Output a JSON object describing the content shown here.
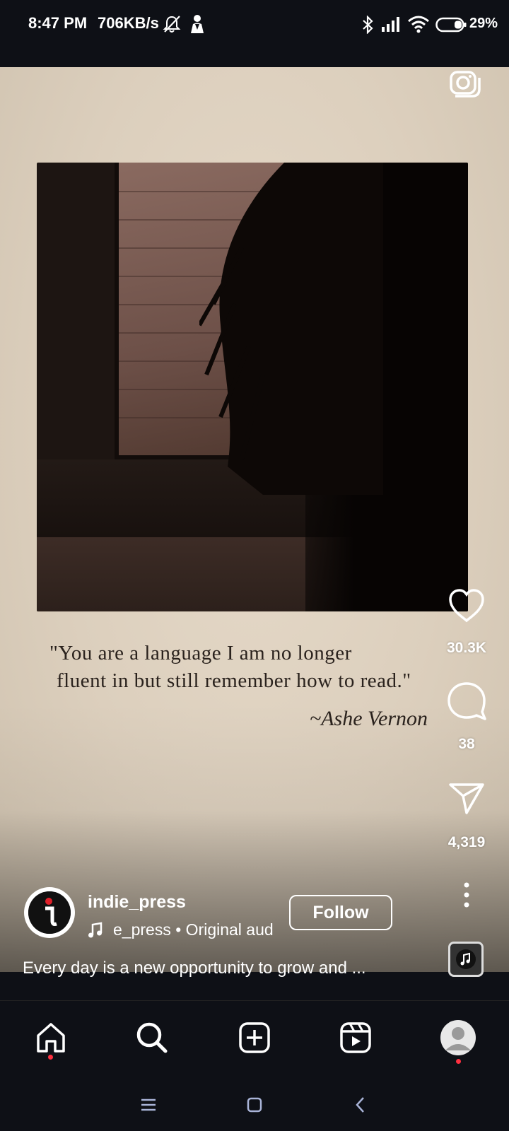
{
  "status_bar": {
    "time": "8:47 PM",
    "speed": "706KB/s",
    "battery": "29%"
  },
  "post": {
    "quote_line1": "\"You are a language I am no longer",
    "quote_line2": "fluent in but still remember how to read.\"",
    "quote_author": "~Ashe Vernon"
  },
  "actions": {
    "likes": "30.3K",
    "comments": "38",
    "shares": "4,319"
  },
  "author": {
    "username": "indie_press",
    "audio": "e_press • Original aud",
    "follow_label": "Follow",
    "caption": "Every day is a new opportunity to grow and ..."
  },
  "nav": {
    "items": [
      "home-icon",
      "search-icon",
      "create-icon",
      "reels-icon",
      "profile-icon"
    ]
  },
  "colors": {
    "background": "#0e1016",
    "notification_dot": "#ff3040",
    "reel_paper": "#ddd0be"
  }
}
